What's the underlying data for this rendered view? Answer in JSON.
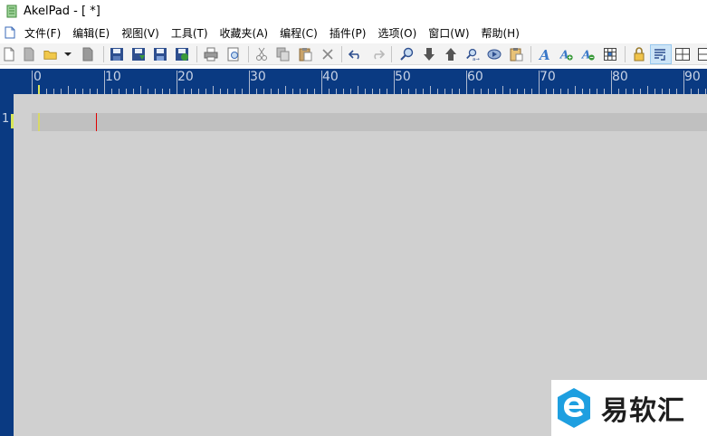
{
  "window": {
    "title": "AkelPad - [ *]"
  },
  "menu": {
    "items": [
      {
        "label": "文件(F)"
      },
      {
        "label": "编辑(E)"
      },
      {
        "label": "视图(V)"
      },
      {
        "label": "工具(T)"
      },
      {
        "label": "收藏夹(A)"
      },
      {
        "label": "编程(C)"
      },
      {
        "label": "插件(P)"
      },
      {
        "label": "选项(O)"
      },
      {
        "label": "窗口(W)"
      },
      {
        "label": "帮助(H)"
      }
    ]
  },
  "toolbar": {
    "buttons": [
      {
        "icon": "new-document-icon"
      },
      {
        "icon": "new-window-icon"
      },
      {
        "icon": "open-folder-icon"
      },
      {
        "icon": "dropdown-arrow-icon"
      },
      {
        "icon": "close-document-icon"
      },
      {
        "icon": "save-icon"
      },
      {
        "icon": "save-as-icon"
      },
      {
        "icon": "save-all-icon"
      },
      {
        "icon": "save-session-icon"
      },
      {
        "icon": "print-icon"
      },
      {
        "icon": "print-preview-icon"
      },
      {
        "icon": "cut-icon"
      },
      {
        "icon": "copy-icon"
      },
      {
        "icon": "paste-icon"
      },
      {
        "icon": "delete-icon"
      },
      {
        "icon": "undo-icon"
      },
      {
        "icon": "redo-icon"
      },
      {
        "icon": "find-icon"
      },
      {
        "icon": "find-next-icon"
      },
      {
        "icon": "find-previous-icon"
      },
      {
        "icon": "replace-icon"
      },
      {
        "icon": "goto-icon"
      },
      {
        "icon": "clipboard-icon"
      },
      {
        "icon": "font-icon"
      },
      {
        "icon": "font-increase-icon"
      },
      {
        "icon": "font-decrease-icon"
      },
      {
        "icon": "character-map-icon"
      },
      {
        "icon": "read-only-lock-icon"
      },
      {
        "icon": "word-wrap-icon"
      },
      {
        "icon": "split-window-icon"
      },
      {
        "icon": "more-icon"
      }
    ],
    "active_icon": "word-wrap-icon"
  },
  "ruler": {
    "labels": [
      "0",
      "10",
      "20",
      "30",
      "40",
      "50",
      "60",
      "70",
      "80",
      "90"
    ]
  },
  "editor": {
    "line_numbers": [
      "1"
    ],
    "text": ""
  },
  "watermark": {
    "text": "易软汇"
  },
  "colors": {
    "frame": "#0a3a82",
    "text_background": "#d0d0d0",
    "current_line": "#c0c0c0",
    "caret": "#e00000",
    "marker": "#d8d866",
    "toolbar": "#f3f3f3"
  }
}
